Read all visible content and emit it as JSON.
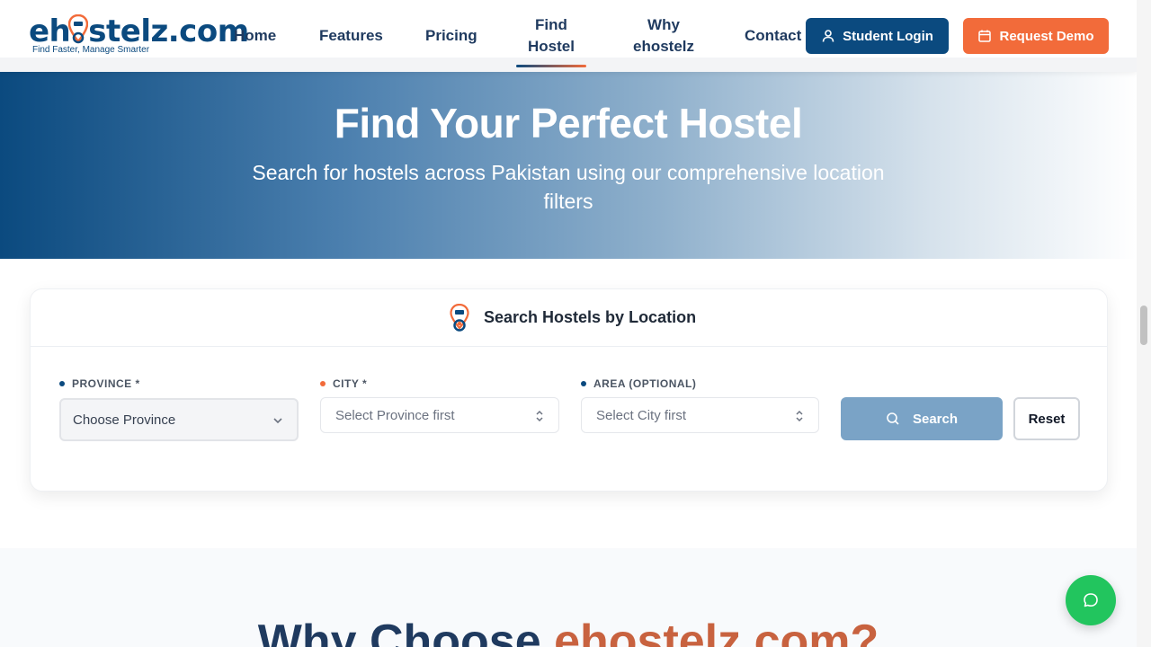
{
  "header": {
    "logo_text": "ehostelz.com",
    "logo_tagline": "Find Faster, Manage Smarter",
    "nav": {
      "home": "Home",
      "features": "Features",
      "pricing": "Pricing",
      "find_hostel_line1": "Find",
      "find_hostel_line2": "Hostel",
      "why_line1": "Why",
      "why_line2": "ehostelz",
      "contact": "Contact"
    },
    "student_login": "Student Login",
    "request_demo": "Request Demo",
    "active_nav": "Find Hostel"
  },
  "hero": {
    "title": "Find Your Perfect Hostel",
    "subtitle": "Search for hostels across Pakistan using our comprehensive location filters"
  },
  "search_card": {
    "title": "Search Hostels by Location",
    "province": {
      "label": "PROVINCE *",
      "value": "Choose Province"
    },
    "city": {
      "label": "CITY *",
      "value": "Select Province first"
    },
    "area": {
      "label": "AREA (OPTIONAL)",
      "value": "Select City first"
    },
    "search_button": "Search",
    "reset_button": "Reset"
  },
  "why_section": {
    "title_prefix": "Why Choose ",
    "title_brand": "ehostelz.com?"
  },
  "colors": {
    "primary": "#0b4a7f",
    "accent": "#f26b3a",
    "chat": "#22c55e"
  },
  "icons": {
    "student_login": "user-icon",
    "request_demo": "calendar-icon",
    "search": "search-icon",
    "chat": "chat-icon",
    "location": "location-pin-icon"
  }
}
